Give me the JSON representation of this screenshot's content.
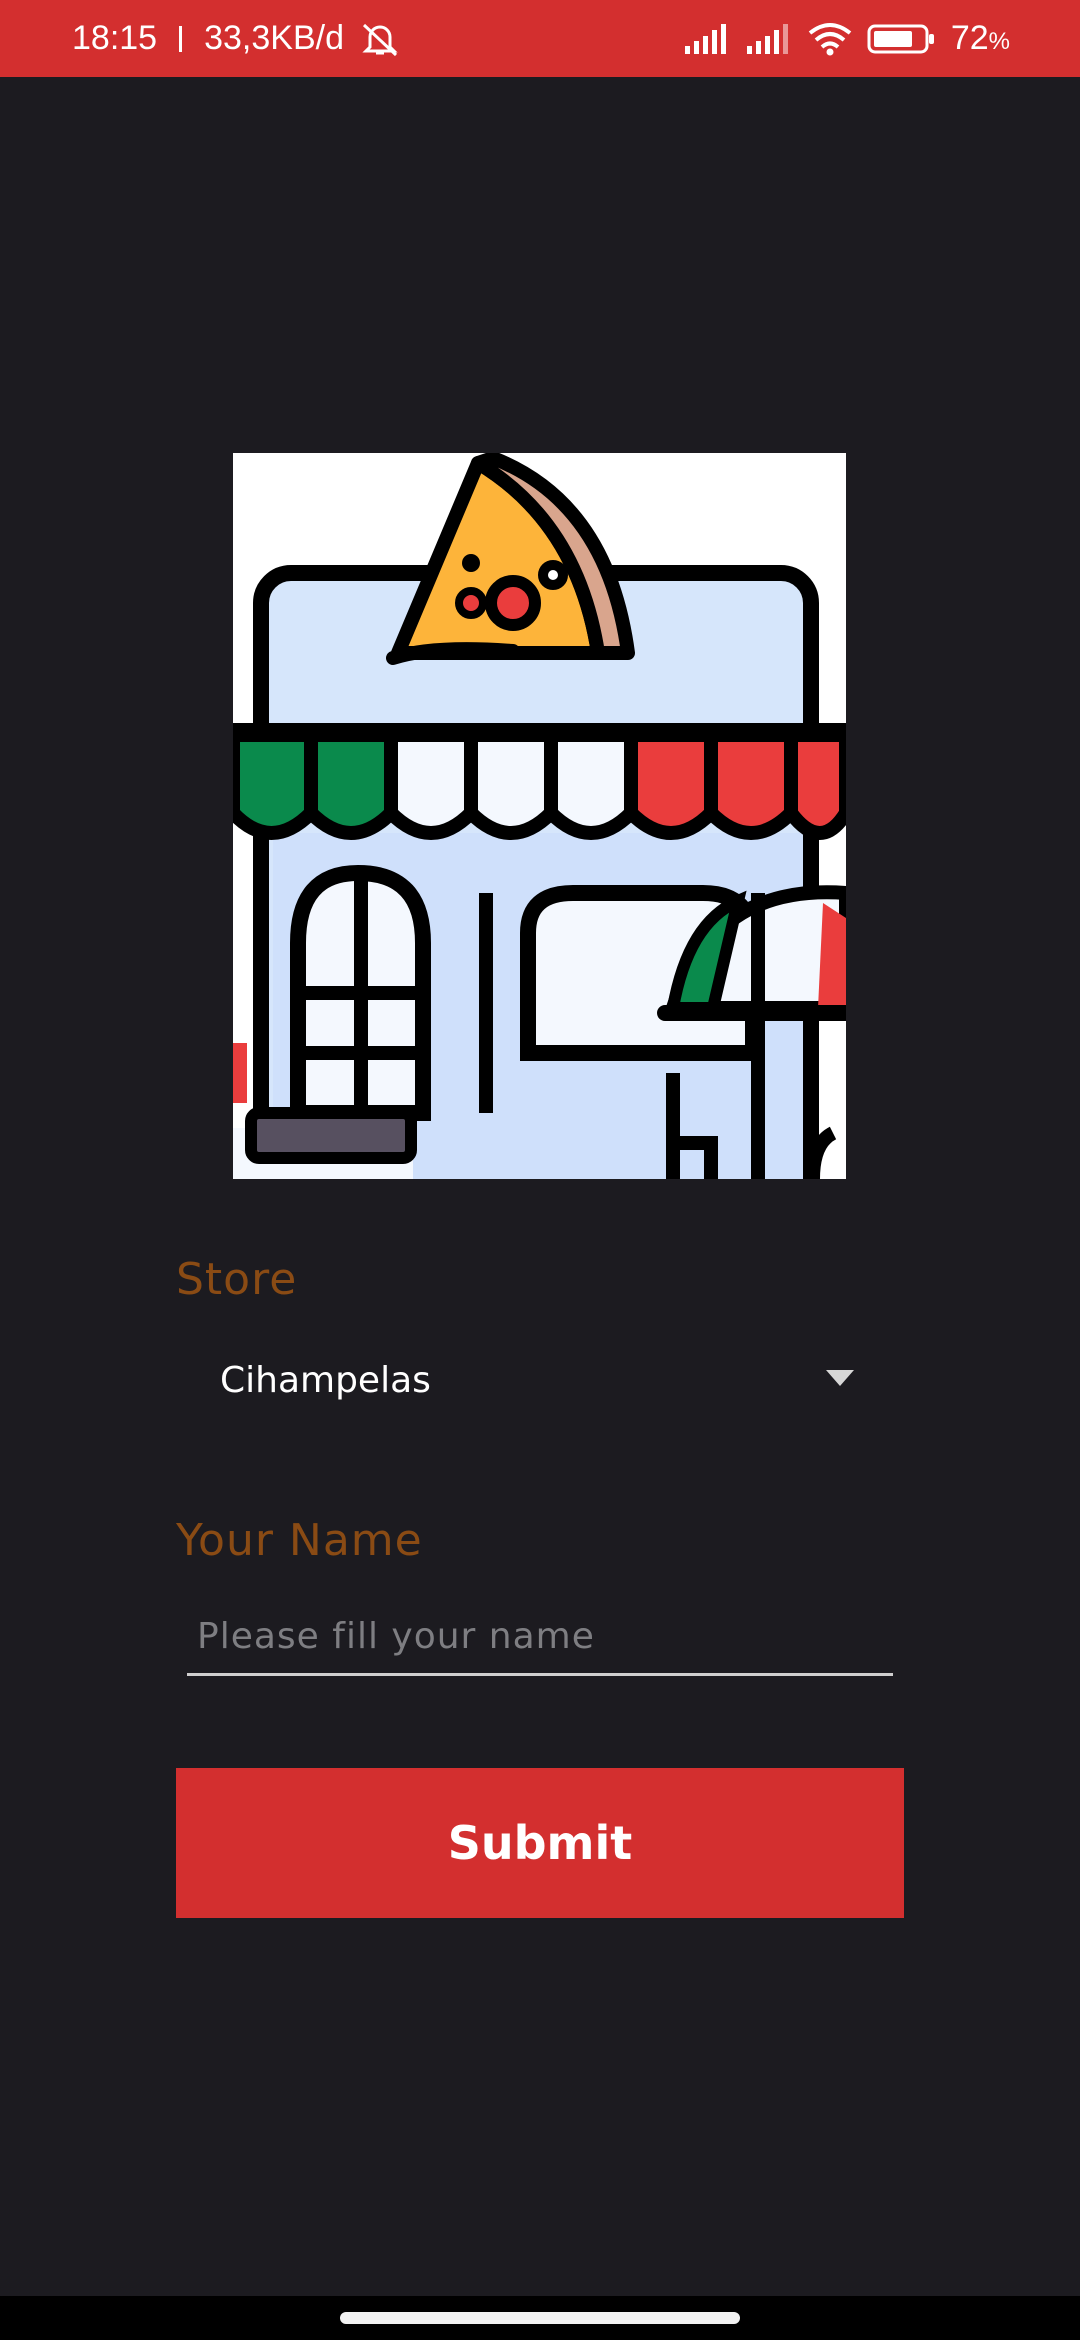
{
  "status_bar": {
    "time": "18:15",
    "speed": "33,3KB/d",
    "battery": "72",
    "battery_unit": "%",
    "icons": [
      "mute-icon",
      "signal-icon",
      "signal-icon",
      "wifi-icon",
      "battery-icon"
    ]
  },
  "hero": {
    "image_icon": "pizza-store-illustration",
    "colors": {
      "green": "#0a8a4c",
      "red": "#ea3d3d",
      "pizza": "#fdb43a",
      "wall": "#d6e6fb"
    }
  },
  "form": {
    "store_label": "Store",
    "store_value": "Cihampelas",
    "name_label": "Your Name",
    "name_placeholder": "Please fill your name",
    "submit_label": "Submit"
  },
  "colors": {
    "accent": "#d32f2f",
    "label": "#8a4b14",
    "background": "#1c1b20"
  }
}
